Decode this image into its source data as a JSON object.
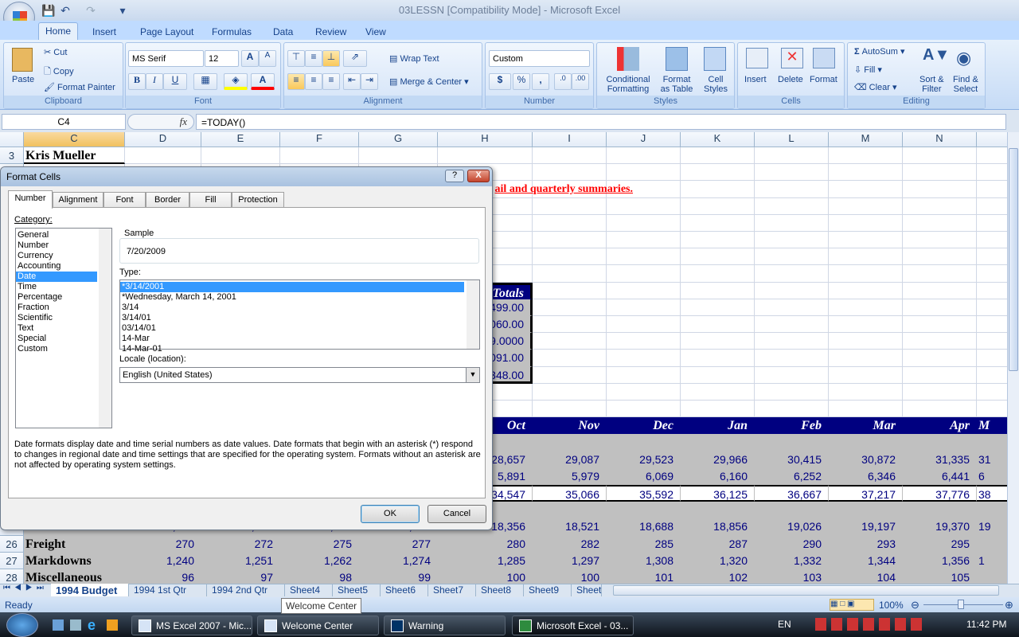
{
  "window": {
    "title": "03LESSN  [Compatibility Mode] - Microsoft Excel"
  },
  "ribbon": {
    "tabs": [
      "Home",
      "Insert",
      "Page Layout",
      "Formulas",
      "Data",
      "Review",
      "View"
    ],
    "clipboard": {
      "label": "Clipboard",
      "paste": "Paste",
      "cut": "Cut",
      "copy": "Copy",
      "format_painter": "Format Painter"
    },
    "font": {
      "label": "Font",
      "name": "MS Serif",
      "size": "12",
      "bold": "B",
      "italic": "I",
      "underline": "U",
      "fill_color": "#ffff00",
      "font_color": "#ff0000"
    },
    "alignment": {
      "label": "Alignment",
      "wrap_text": "Wrap Text",
      "merge_center": "Merge & Center"
    },
    "number": {
      "label": "Number",
      "format": "Custom",
      "currency": "$",
      "percent": "%",
      "comma": ","
    },
    "styles": {
      "label": "Styles",
      "conditional": "Conditional",
      "conditional2": "Formatting",
      "format_table": "Format",
      "format_table2": "as Table",
      "cell_styles": "Cell",
      "cell_styles2": "Styles"
    },
    "cells": {
      "label": "Cells",
      "insert": "Insert",
      "delete": "Delete",
      "format": "Format"
    },
    "editing": {
      "label": "Editing",
      "autosum": "AutoSum",
      "fill": "Fill",
      "clear": "Clear",
      "sort": "Sort &",
      "sort2": "Filter",
      "find": "Find &",
      "find2": "Select"
    }
  },
  "formula_bar": {
    "name_box": "C4",
    "fx": "fx",
    "formula": "=TODAY()"
  },
  "sheet": {
    "columns": [
      "C",
      "D",
      "E",
      "F",
      "G",
      "H",
      "I",
      "J",
      "K",
      "L",
      "M",
      "N",
      "O"
    ],
    "selected_column": "C",
    "row_numbers": {
      "3": "3",
      "25": "25",
      "26": "26",
      "27": "27",
      "28": "28"
    },
    "note": "ail and quarterly summaries.",
    "cells": [
      {
        "r": 3,
        "c": "C",
        "v": "Kris Mueller",
        "t": "lbl"
      },
      {
        "r": 11,
        "c": "H",
        "v": "Totals",
        "t": "navy"
      },
      {
        "r": 12,
        "c": "H",
        "v": "499.00",
        "t": "gray"
      },
      {
        "r": 13,
        "c": "H",
        "v": "060.00",
        "t": "gray"
      },
      {
        "r": 14,
        "c": "H",
        "v": "9.0000",
        "t": "gray"
      },
      {
        "r": 15,
        "c": "H",
        "v": "091.00",
        "t": "gray"
      },
      {
        "r": 16,
        "c": "H",
        "v": "348.00",
        "t": "gray"
      },
      {
        "r": 19,
        "c": "H",
        "v": "Oct"
      },
      {
        "r": 19,
        "c": "I",
        "v": "Nov"
      },
      {
        "r": 19,
        "c": "J",
        "v": "Dec"
      },
      {
        "r": 19,
        "c": "K",
        "v": "Jan"
      },
      {
        "r": 19,
        "c": "L",
        "v": "Feb"
      },
      {
        "r": 19,
        "c": "M",
        "v": "Mar"
      },
      {
        "r": 19,
        "c": "N",
        "v": "Apr"
      },
      {
        "r": 19,
        "c": "O",
        "v": "M",
        "t": "left"
      },
      {
        "r": 21,
        "c": "H",
        "v": "28,657"
      },
      {
        "r": 21,
        "c": "I",
        "v": "29,087"
      },
      {
        "r": 21,
        "c": "J",
        "v": "29,523"
      },
      {
        "r": 21,
        "c": "K",
        "v": "29,966"
      },
      {
        "r": 21,
        "c": "L",
        "v": "30,415"
      },
      {
        "r": 21,
        "c": "M",
        "v": "30,872"
      },
      {
        "r": 21,
        "c": "N",
        "v": "31,335"
      },
      {
        "r": 21,
        "c": "O",
        "v": "31",
        "t": "left"
      },
      {
        "r": 22,
        "c": "H",
        "v": "5,891"
      },
      {
        "r": 22,
        "c": "I",
        "v": "5,979"
      },
      {
        "r": 22,
        "c": "J",
        "v": "6,069"
      },
      {
        "r": 22,
        "c": "K",
        "v": "6,160"
      },
      {
        "r": 22,
        "c": "L",
        "v": "6,252"
      },
      {
        "r": 22,
        "c": "M",
        "v": "6,346"
      },
      {
        "r": 22,
        "c": "N",
        "v": "6,441"
      },
      {
        "r": 22,
        "c": "O",
        "v": "6",
        "t": "left"
      },
      {
        "r": 23,
        "c": "H",
        "v": "34,547"
      },
      {
        "r": 23,
        "c": "I",
        "v": "35,066"
      },
      {
        "r": 23,
        "c": "J",
        "v": "35,592"
      },
      {
        "r": 23,
        "c": "K",
        "v": "36,125"
      },
      {
        "r": 23,
        "c": "L",
        "v": "36,667"
      },
      {
        "r": 23,
        "c": "M",
        "v": "37,217"
      },
      {
        "r": 23,
        "c": "N",
        "v": "37,776"
      },
      {
        "r": 23,
        "c": "O",
        "v": "38",
        "t": "left"
      },
      {
        "r": 25,
        "c": "C",
        "v": "Goods",
        "t": "lbl"
      },
      {
        "r": 25,
        "c": "D",
        "v": "17,710"
      },
      {
        "r": 25,
        "c": "E",
        "v": "17,889"
      },
      {
        "r": 25,
        "c": "F",
        "v": "18,030"
      },
      {
        "r": 25,
        "c": "G",
        "v": "18,192"
      },
      {
        "r": 25,
        "c": "H",
        "v": "18,356"
      },
      {
        "r": 25,
        "c": "I",
        "v": "18,521"
      },
      {
        "r": 25,
        "c": "J",
        "v": "18,688"
      },
      {
        "r": 25,
        "c": "K",
        "v": "18,856"
      },
      {
        "r": 25,
        "c": "L",
        "v": "19,026"
      },
      {
        "r": 25,
        "c": "M",
        "v": "19,197"
      },
      {
        "r": 25,
        "c": "N",
        "v": "19,370"
      },
      {
        "r": 25,
        "c": "O",
        "v": "19",
        "t": "left"
      },
      {
        "r": 26,
        "c": "C",
        "v": "Freight",
        "t": "lbl"
      },
      {
        "r": 26,
        "c": "D",
        "v": "270"
      },
      {
        "r": 26,
        "c": "E",
        "v": "272"
      },
      {
        "r": 26,
        "c": "F",
        "v": "275"
      },
      {
        "r": 26,
        "c": "G",
        "v": "277"
      },
      {
        "r": 26,
        "c": "H",
        "v": "280"
      },
      {
        "r": 26,
        "c": "I",
        "v": "282"
      },
      {
        "r": 26,
        "c": "J",
        "v": "285"
      },
      {
        "r": 26,
        "c": "K",
        "v": "287"
      },
      {
        "r": 26,
        "c": "L",
        "v": "290"
      },
      {
        "r": 26,
        "c": "M",
        "v": "293"
      },
      {
        "r": 26,
        "c": "N",
        "v": "295"
      },
      {
        "r": 27,
        "c": "C",
        "v": "Markdowns",
        "t": "lbl"
      },
      {
        "r": 27,
        "c": "D",
        "v": "1,240"
      },
      {
        "r": 27,
        "c": "E",
        "v": "1,251"
      },
      {
        "r": 27,
        "c": "F",
        "v": "1,262"
      },
      {
        "r": 27,
        "c": "G",
        "v": "1,274"
      },
      {
        "r": 27,
        "c": "H",
        "v": "1,285"
      },
      {
        "r": 27,
        "c": "I",
        "v": "1,297"
      },
      {
        "r": 27,
        "c": "J",
        "v": "1,308"
      },
      {
        "r": 27,
        "c": "K",
        "v": "1,320"
      },
      {
        "r": 27,
        "c": "L",
        "v": "1,332"
      },
      {
        "r": 27,
        "c": "M",
        "v": "1,344"
      },
      {
        "r": 27,
        "c": "N",
        "v": "1,356"
      },
      {
        "r": 27,
        "c": "O",
        "v": "1",
        "t": "left"
      },
      {
        "r": 28,
        "c": "C",
        "v": "Miscellaneous",
        "t": "lbl"
      },
      {
        "r": 28,
        "c": "D",
        "v": "96"
      },
      {
        "r": 28,
        "c": "E",
        "v": "97"
      },
      {
        "r": 28,
        "c": "F",
        "v": "98"
      },
      {
        "r": 28,
        "c": "G",
        "v": "99"
      },
      {
        "r": 28,
        "c": "H",
        "v": "100"
      },
      {
        "r": 28,
        "c": "I",
        "v": "100"
      },
      {
        "r": 28,
        "c": "J",
        "v": "101"
      },
      {
        "r": 28,
        "c": "K",
        "v": "102"
      },
      {
        "r": 28,
        "c": "L",
        "v": "103"
      },
      {
        "r": 28,
        "c": "M",
        "v": "104"
      },
      {
        "r": 28,
        "c": "N",
        "v": "105"
      }
    ],
    "tabs": [
      "1994 Budget",
      "1994 1st Qtr",
      "1994 2nd Qtr",
      "Sheet4",
      "Sheet5",
      "Sheet6",
      "Sheet7",
      "Sheet8",
      "Sheet9",
      "Sheet"
    ],
    "active_tab": "1994 Budget"
  },
  "dialog": {
    "title": "Format Cells",
    "help": "?",
    "close": "X",
    "tabs": [
      "Number",
      "Alignment",
      "Font",
      "Border",
      "Fill",
      "Protection"
    ],
    "category_label": "Category:",
    "categories": [
      "General",
      "Number",
      "Currency",
      "Accounting",
      "Date",
      "Time",
      "Percentage",
      "Fraction",
      "Scientific",
      "Text",
      "Special",
      "Custom"
    ],
    "selected_category": "Date",
    "sample_label": "Sample",
    "sample_value": "7/20/2009",
    "type_label": "Type:",
    "types": [
      "*3/14/2001",
      "*Wednesday, March 14, 2001",
      "3/14",
      "3/14/01",
      "03/14/01",
      "14-Mar",
      "14-Mar-01"
    ],
    "selected_type": "*3/14/2001",
    "locale_label": "Locale (location):",
    "locale_value": "English (United States)",
    "description": "Date formats display date and time serial numbers as date values.  Date formats that begin with an asterisk (*) respond to changes in regional date and time settings that are specified for the operating system. Formats without an asterisk are not affected by operating system settings.",
    "ok": "OK",
    "cancel": "Cancel"
  },
  "status": {
    "text": "Ready",
    "zoom": "100%",
    "tooltip": "Welcome Center"
  },
  "taskbar": {
    "items": [
      "MS Excel 2007 - Mic...",
      "Welcome Center",
      "Warning",
      "Microsoft Excel - 03..."
    ],
    "lang": "EN",
    "time": "11:42 PM"
  }
}
